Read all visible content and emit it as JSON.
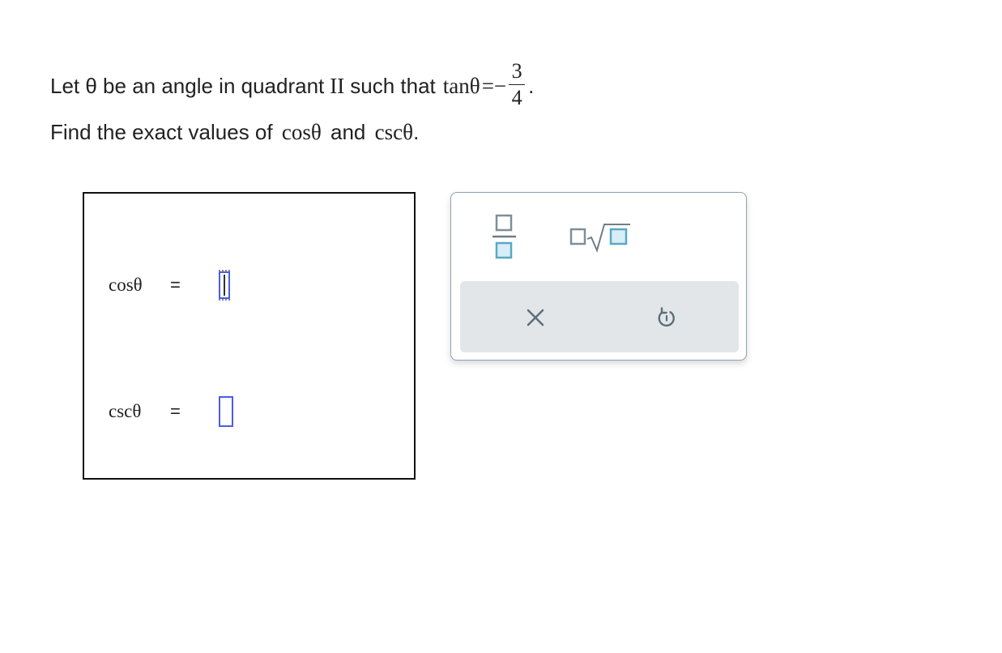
{
  "problem": {
    "line1_prefix": "Let θ be an angle in quadrant",
    "quadrant": "II",
    "line1_mid": "such that",
    "tan_expr": "tanθ",
    "equals_minus": "=−",
    "frac_num": "3",
    "frac_den": "4",
    "line1_end": ".",
    "line2_prefix": "Find the exact values of",
    "cos_expr": "cosθ",
    "line2_and": "and",
    "csc_expr": "cscθ",
    "line2_end": "."
  },
  "answers": {
    "cos_label": "cosθ",
    "csc_label": "cscθ",
    "equals": "=",
    "cos_value": "",
    "csc_value": ""
  },
  "palette": {
    "buttons": [
      "fraction",
      "square-root",
      "clear",
      "undo"
    ],
    "accent_color": "#5aa8c4",
    "outline_color": "#7f8f97",
    "bar_color": "#e2e6e9"
  }
}
